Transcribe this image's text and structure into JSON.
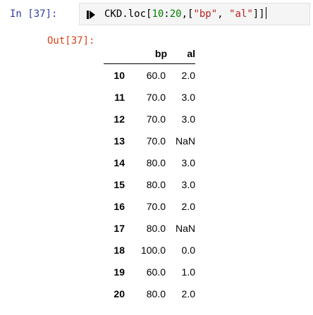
{
  "cell": {
    "in_prompt": "In [37]:",
    "out_prompt": "Out[37]:",
    "code": {
      "var": "CKD.loc[",
      "n1": "10",
      "colon": ":",
      "n2": "20",
      "mid1": ",[",
      "s1": "\"bp\"",
      "mid2": ", ",
      "s2": "\"al\"",
      "end": "]]"
    },
    "run_icon": "run-cell-icon"
  },
  "table": {
    "columns": [
      "bp",
      "al"
    ],
    "rows": [
      {
        "index": "10",
        "bp": "60.0",
        "al": "2.0"
      },
      {
        "index": "11",
        "bp": "70.0",
        "al": "3.0"
      },
      {
        "index": "12",
        "bp": "70.0",
        "al": "3.0"
      },
      {
        "index": "13",
        "bp": "70.0",
        "al": "NaN"
      },
      {
        "index": "14",
        "bp": "80.0",
        "al": "3.0"
      },
      {
        "index": "15",
        "bp": "80.0",
        "al": "3.0"
      },
      {
        "index": "16",
        "bp": "70.0",
        "al": "2.0"
      },
      {
        "index": "17",
        "bp": "80.0",
        "al": "NaN"
      },
      {
        "index": "18",
        "bp": "100.0",
        "al": "0.0"
      },
      {
        "index": "19",
        "bp": "60.0",
        "al": "1.0"
      },
      {
        "index": "20",
        "bp": "80.0",
        "al": "2.0"
      }
    ]
  }
}
